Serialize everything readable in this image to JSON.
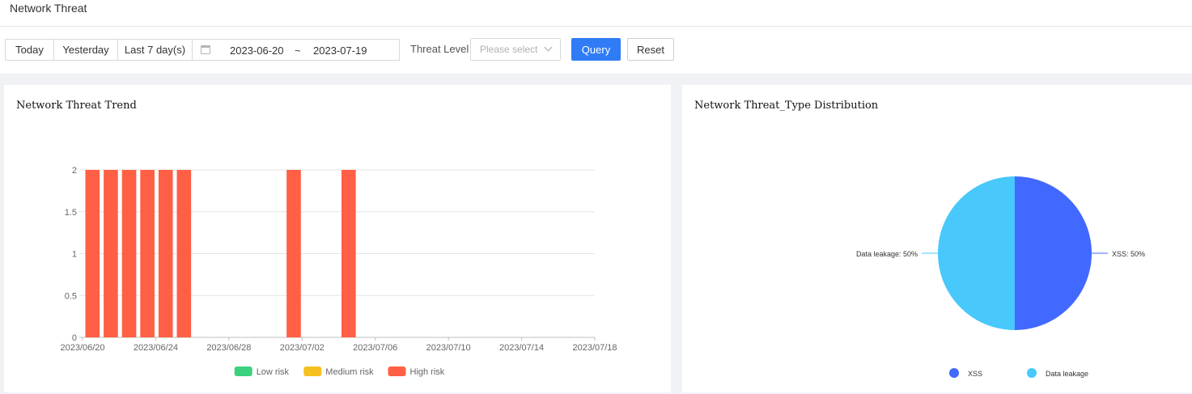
{
  "page": {
    "title": "Network Threat"
  },
  "filters": {
    "today_label": "Today",
    "yesterday_label": "Yesterday",
    "last7_label": "Last 7 day(s)",
    "date_start": "2023-06-20",
    "date_separator": "~",
    "date_end": "2023-07-19",
    "threat_level_label": "Threat Level",
    "threat_level_placeholder": "Please select",
    "query_label": "Query",
    "reset_label": "Reset"
  },
  "colors": {
    "primary": "#2f7cf6",
    "low_risk": "#3cd17f",
    "medium_risk": "#f7c01d",
    "high_risk": "#ff5f45",
    "xss": "#4168ff",
    "data_leakage": "#48c8fb"
  },
  "trend_panel": {
    "title": "Network Threat Trend"
  },
  "distribution_panel": {
    "title": "Network Threat_Type Distribution"
  },
  "chart_data": [
    {
      "type": "bar",
      "title": "Network Threat Trend",
      "x_tick_labels": [
        "2023/06/20",
        "2023/06/24",
        "2023/06/28",
        "2023/07/02",
        "2023/07/06",
        "2023/07/10",
        "2023/07/14",
        "2023/07/18"
      ],
      "y_tick_labels": [
        "0",
        "0.5",
        "1",
        "1.5",
        "2"
      ],
      "ylim": [
        0,
        2
      ],
      "grid": true,
      "legend_position": "bottom",
      "series": [
        {
          "name": "Low risk",
          "color": "#3cd17f",
          "points": []
        },
        {
          "name": "Medium risk",
          "color": "#f7c01d",
          "points": []
        },
        {
          "name": "High risk",
          "color": "#ff5f45",
          "points": [
            {
              "x": "2023/06/20",
              "y": 2
            },
            {
              "x": "2023/06/21",
              "y": 2
            },
            {
              "x": "2023/06/22",
              "y": 2
            },
            {
              "x": "2023/06/23",
              "y": 2
            },
            {
              "x": "2023/06/24",
              "y": 2
            },
            {
              "x": "2023/06/25",
              "y": 2
            },
            {
              "x": "2023/07/01",
              "y": 2
            },
            {
              "x": "2023/07/04",
              "y": 2
            }
          ]
        }
      ]
    },
    {
      "type": "pie",
      "title": "Network Threat_Type Distribution",
      "legend_position": "bottom",
      "slices": [
        {
          "name": "XSS",
          "value": 50,
          "label": "XSS: 50%",
          "color": "#4168ff"
        },
        {
          "name": "Data leakage",
          "value": 50,
          "label": "Data leakage:  50%",
          "color": "#48c8fb"
        }
      ]
    }
  ]
}
